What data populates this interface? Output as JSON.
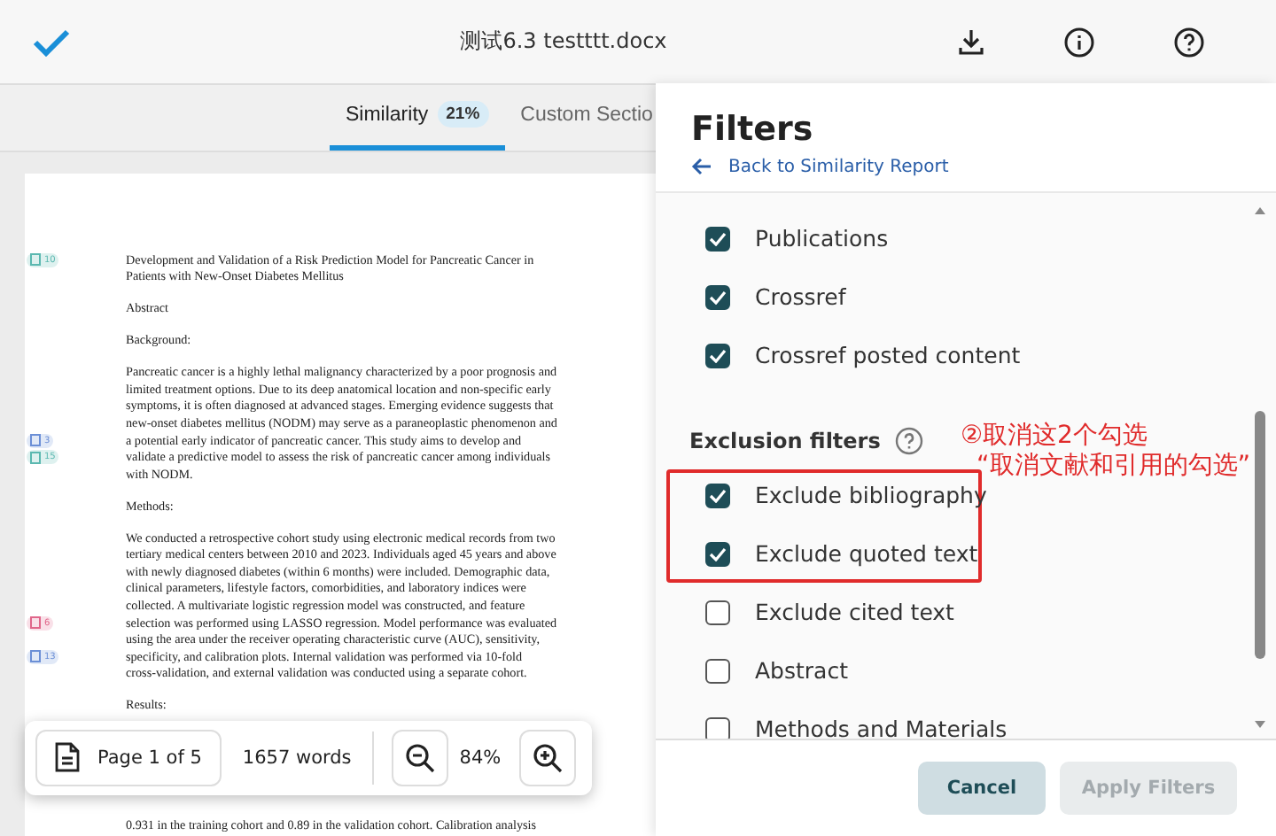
{
  "header": {
    "title": "测试6.3 testttt.docx"
  },
  "tabs": [
    {
      "label": "Similarity",
      "badge": "21%",
      "selected": true
    },
    {
      "label": "Custom Sectio",
      "selected": false
    }
  ],
  "document": {
    "paragraphs": [
      {
        "lines": [
          {
            "text": "Development and Validation of a Risk Prediction Model for Pancreatic Cancer in",
            "badge": {
              "count": "10",
              "color": "#5bb8b0"
            }
          },
          {
            "text": "Patients with New-Onset Diabetes Mellitus"
          }
        ]
      },
      {
        "lines": [
          {
            "text": "Abstract"
          }
        ]
      },
      {
        "lines": [
          {
            "text": "Background:"
          }
        ]
      },
      {
        "lines": [
          {
            "text": "Pancreatic cancer is a highly lethal malignancy characterized by a poor prognosis and"
          },
          {
            "text": "limited treatment options. Due to its deep anatomical location and non-specific early"
          },
          {
            "text": "symptoms, it is often diagnosed at advanced stages. Emerging evidence suggests that"
          },
          {
            "text": "new-onset diabetes mellitus (NODM) may serve as a paraneoplastic phenomenon and"
          },
          {
            "text": "a potential early indicator of pancreatic cancer. This study aims to develop and",
            "badge": {
              "count": "3",
              "color": "#6b8fd6"
            }
          },
          {
            "text": "validate a predictive model to assess the risk of pancreatic cancer among individuals",
            "badge": {
              "count": "15",
              "color": "#5bb8b0"
            }
          },
          {
            "text": "with NODM."
          }
        ]
      },
      {
        "lines": [
          {
            "text": "Methods:"
          }
        ]
      },
      {
        "lines": [
          {
            "text": "We conducted a retrospective cohort study using electronic medical records from two"
          },
          {
            "text": "tertiary medical centers between 2010 and 2023. Individuals aged 45 years and above"
          },
          {
            "text": "with newly diagnosed diabetes (within 6 months) were included. Demographic data,"
          },
          {
            "text": "clinical parameters, lifestyle factors, comorbidities, and laboratory indices were"
          },
          {
            "text": "collected. A multivariate logistic regression model was constructed, and feature"
          },
          {
            "text": "selection was performed using LASSO regression. Model performance was evaluated",
            "badge": {
              "count": "6",
              "color": "#e0668a"
            }
          },
          {
            "text": "using the area under the receiver operating characteristic curve (AUC), sensitivity,"
          },
          {
            "text": "specificity, and calibration plots. Internal validation was performed via 10-fold",
            "badge": {
              "count": "13",
              "color": "#6b8fd6"
            }
          },
          {
            "text": "cross-validation, and external validation was conducted using a separate cohort."
          }
        ]
      },
      {
        "lines": [
          {
            "text": "Results:"
          }
        ]
      },
      {
        "lines": [
          {
            "text": "0.931 in the training cohort and 0.89 in the validation cohort. Calibration analysis"
          }
        ]
      }
    ]
  },
  "doc_toolbar": {
    "page": "Page 1 of 5",
    "words": "1657 words",
    "zoom": "84%"
  },
  "filters": {
    "title": "Filters",
    "back_link": "Back to Similarity Report",
    "items": [
      {
        "kind": "checkbox",
        "label": "Publications",
        "checked": true
      },
      {
        "kind": "checkbox",
        "label": "Crossref",
        "checked": true
      },
      {
        "kind": "checkbox",
        "label": "Crossref posted content",
        "checked": true
      },
      {
        "kind": "heading",
        "label": "Exclusion filters"
      },
      {
        "kind": "checkbox",
        "label": "Exclude bibliography",
        "checked": true
      },
      {
        "kind": "checkbox",
        "label": "Exclude quoted text",
        "checked": true
      },
      {
        "kind": "checkbox",
        "label": "Exclude cited text",
        "checked": false
      },
      {
        "kind": "checkbox",
        "label": "Abstract",
        "checked": false
      },
      {
        "kind": "checkbox",
        "label": "Methods and Materials",
        "checked": false
      }
    ],
    "buttons": [
      {
        "label": "Cancel",
        "disabled": false
      },
      {
        "label": "Apply Filters",
        "disabled": true
      }
    ]
  },
  "annotation": {
    "lines": [
      "②取消这2个勾选",
      "“取消文献和引用的勾选”"
    ]
  }
}
